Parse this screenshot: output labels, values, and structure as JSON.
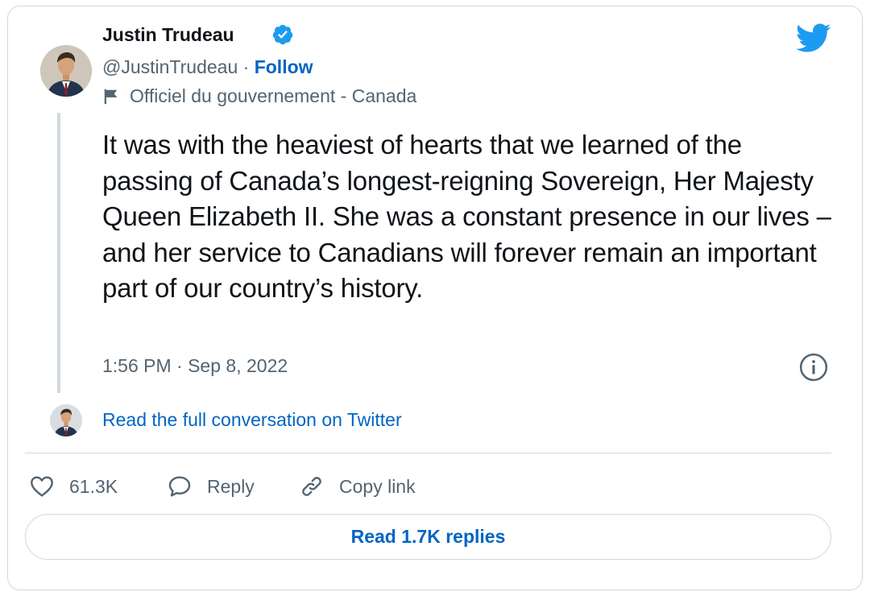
{
  "tweet": {
    "author_name": "Justin Trudeau",
    "handle": "@JustinTrudeau",
    "separator": " · ",
    "follow_label": "Follow",
    "gov_label": "Officiel du gouvernement - Canada",
    "text": "It was with the heaviest of hearts that we learned of the passing of Canada’s longest-reigning Sovereign, Her Majesty Queen Elizabeth II. She was a constant presence in our lives – and her service to Canadians will forever remain an important part of our country’s history.",
    "timestamp": "1:56 PM · Sep 8, 2022"
  },
  "conversation": {
    "link_label": "Read the full conversation on Twitter"
  },
  "actions": {
    "likes": "61.3K",
    "reply_label": "Reply",
    "copy_label": "Copy link"
  },
  "replies": {
    "button_label": "Read 1.7K replies"
  },
  "icons": {
    "verified": "verified-badge-icon",
    "twitter": "twitter-bird-icon",
    "flag": "flag-icon",
    "info": "info-icon",
    "like": "heart-icon",
    "reply": "speech-bubble-icon",
    "copy": "link-icon"
  },
  "colors": {
    "link_blue": "#0065c4",
    "twitter_blue": "#1d9bf0",
    "secondary_text": "#536471",
    "border": "#cfd9de"
  }
}
